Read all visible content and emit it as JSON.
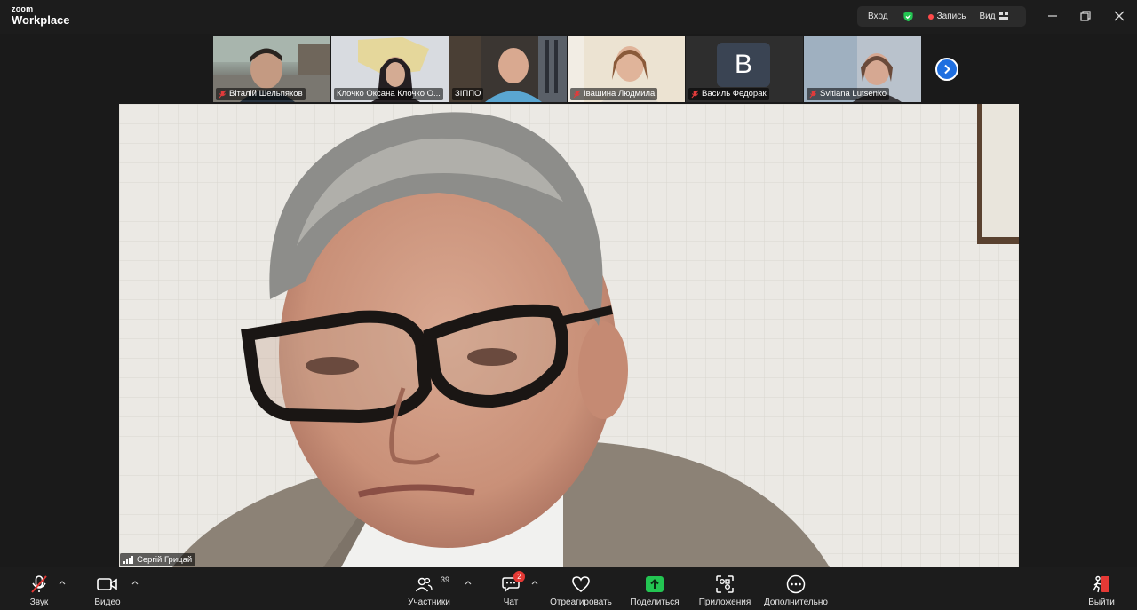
{
  "window": {
    "logo_line1": "zoom",
    "logo_line2": "Workplace",
    "enter_label": "Вход",
    "record_label": "Запись",
    "view_label": "Вид",
    "shield_icon": "shield-check-icon",
    "colors": {
      "shield": "#23c552",
      "record_dot": "#ff4a4a"
    }
  },
  "participants": [
    {
      "name": "Віталій Шельпяков",
      "muted": true
    },
    {
      "name": "Клочко Оксана Клочко О...",
      "muted": false
    },
    {
      "name": "ЗІППО",
      "muted": false
    },
    {
      "name": "Івашина Людмила",
      "muted": true
    },
    {
      "name": "Василь Федорак",
      "muted": true,
      "avatar_letter": "B"
    },
    {
      "name": "Svitlana Lutsenko",
      "muted": true
    }
  ],
  "speaker": {
    "name": "Сергій Грицай"
  },
  "toolbar": {
    "audio_label": "Звук",
    "video_label": "Видео",
    "participants_label": "Участники",
    "participants_count": "39",
    "chat_label": "Чат",
    "chat_badge": "2",
    "react_label": "Отреагировать",
    "share_label": "Поделиться",
    "apps_label": "Приложения",
    "more_label": "Дополнительно",
    "leave_label": "Выйти",
    "colors": {
      "share": "#23c552",
      "leave": "#e53935",
      "badge": "#e53935",
      "next": "#1f6fe0"
    }
  }
}
